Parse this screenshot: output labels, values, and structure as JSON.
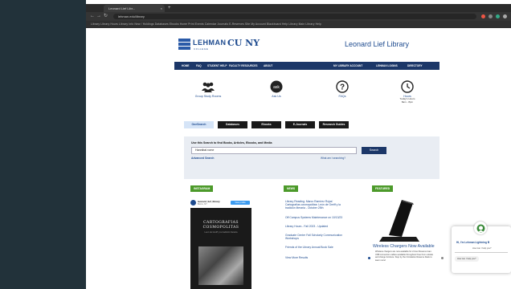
{
  "browser": {
    "tab_title": "Leonard Lief Libr...",
    "tab_close": "×",
    "new_tab": "+",
    "url": "lehman.edu/library",
    "bookmarks": "Library   Library Hours   Library Info   New / Holdings   Databases   Ebooks   Home   Print   Events   Calendar   Journals   E-Reserves   Site   My Account   Blackboard   Help   Library Main   Library Help"
  },
  "header": {
    "logo_name": "LEHMAN",
    "logo_sub": "COLLEGE",
    "cuny": "CU NY",
    "library_name": "Leonard Lief Library"
  },
  "nav": {
    "items": [
      "HOME",
      "FAQ",
      "STUDENT HELP",
      "FACULTY RESOURCES",
      "ABOUT"
    ],
    "right_items": [
      "MY LIBRARY ACCOUNT",
      "LEHMAN LOGINS",
      "DIRECTORY"
    ]
  },
  "quick_links": [
    {
      "label": "Group Study Rooms",
      "icon": "group-icon"
    },
    {
      "label": "Ask Us",
      "icon": "chat-bubble-icon"
    },
    {
      "label": "FAQs",
      "icon": "question-icon"
    },
    {
      "label": "Hours",
      "sub": "Today's Hours",
      "sub2": "8am - 8pm",
      "icon": "clock-icon"
    }
  ],
  "search": {
    "tabs": [
      "OneSearch",
      "Databases",
      "Ebooks",
      "E-Journals",
      "Research Guides"
    ],
    "label": "Use this Search to find Books, Articles, Ebooks, and Media",
    "value": "Hannibal rome",
    "button": "Search",
    "advanced": "Advanced Search",
    "what": "What am I searching?"
  },
  "sections": {
    "instagram": "INSTAGRAM",
    "news": "NEWS",
    "featured": "FEATURED"
  },
  "instagram": {
    "handle": "leonard_lief_library",
    "handle_sub": "Bronx, NY",
    "follow": "View profile",
    "book_title_1": "CARTOGRAFIAS",
    "book_title_2": "COSMOPOLITAS",
    "book_sub": "Leon de Greiff y la tradición literaria"
  },
  "news": {
    "items": [
      "Library Reading: Marco Ramírez Rojas' Cartografías cosmopolitas: León de Greiff y la tradición literaria - October 25th",
      "Off Campus Systems Maintenance on 10/13/23",
      "Library Hours - Fall 2023 - Updated",
      "Graduate Center Fall Scholarly Communication Workshops",
      "Friends of the Library Annual Book Sale"
    ],
    "more": "View More Results"
  },
  "featured": {
    "title": "Wireless Chargers Now Available",
    "text": "Wireless chargers are now available for 2-hour Reserve loan. USB connection cables available throughout Free from outside and charge furniture. Stop by the Circulation Reserve Desk to learn more!"
  },
  "chat": {
    "greeting": "Hi, I'm Lehman Lightning B",
    "ask": "How can I help you?",
    "bubble": "How can I help you?"
  },
  "colors": {
    "navy": "#1c3768",
    "accent_green": "#4c9a2a",
    "link_blue": "#1e4b8f"
  }
}
